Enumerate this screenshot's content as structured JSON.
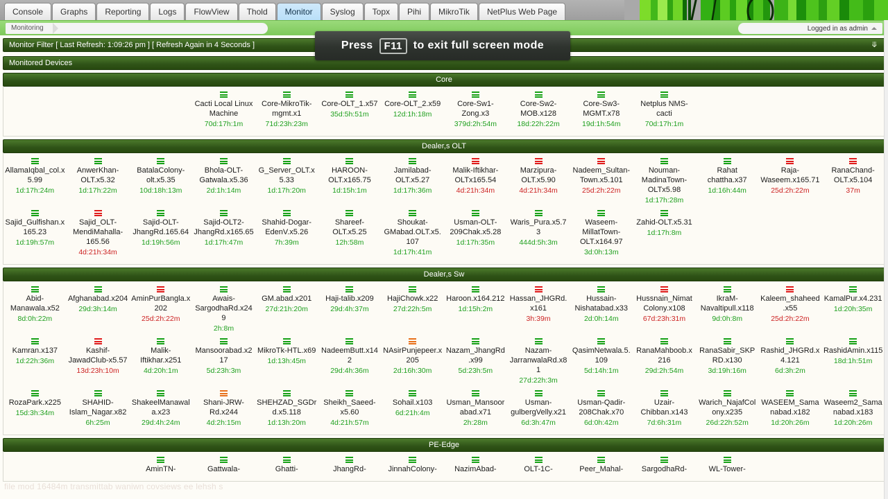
{
  "tabs": [
    {
      "label": "Console",
      "active": false
    },
    {
      "label": "Graphs",
      "active": false
    },
    {
      "label": "Reporting",
      "active": false
    },
    {
      "label": "Logs",
      "active": false
    },
    {
      "label": "FlowView",
      "active": false
    },
    {
      "label": "Thold",
      "active": false
    },
    {
      "label": "Monitor",
      "active": true
    },
    {
      "label": "Syslog",
      "active": false
    },
    {
      "label": "Topx",
      "active": false
    },
    {
      "label": "Pihi",
      "active": false
    },
    {
      "label": "MikroTik",
      "active": false
    },
    {
      "label": "NetPlus Web Page",
      "active": false
    }
  ],
  "breadcrumb": {
    "label": "Monitoring"
  },
  "login": {
    "label": "Logged in as admin"
  },
  "overlay": {
    "prefix": "Press",
    "key": "F11",
    "suffix": "to exit full screen mode"
  },
  "filter_bar": {
    "label": "Monitor Filter [ Last Refresh: 1:09:26 pm ] [ Refresh Again in 4 Seconds ]",
    "chevron": "chevron-double-down-icon"
  },
  "section_header": {
    "label": "Monitored Devices"
  },
  "ghost_text": "file mod 16484m transmittab waniwn  covsiews  ee  lehsh  s",
  "groups": [
    {
      "title": "Core",
      "devices": [
        {
          "name": "",
          "uptime": "",
          "status": "blank"
        },
        {
          "name": "",
          "uptime": "",
          "status": "blank"
        },
        {
          "name": "",
          "uptime": "",
          "status": "blank"
        },
        {
          "name": "Cacti Local Linux Machine",
          "uptime": "70d:17h:1m",
          "status": "up"
        },
        {
          "name": "Core-MikroTik-mgmt.x1",
          "uptime": "71d:23h:23m",
          "status": "up"
        },
        {
          "name": "Core-OLT_1.x57",
          "uptime": "35d:5h:51m",
          "status": "up"
        },
        {
          "name": "Core-OLT_2.x59",
          "uptime": "12d:1h:18m",
          "status": "up"
        },
        {
          "name": "Core-Sw1-Zong.x3",
          "uptime": "379d:2h:54m",
          "status": "up"
        },
        {
          "name": "Core-Sw2-MOB.x128",
          "uptime": "18d:22h:22m",
          "status": "up"
        },
        {
          "name": "Core-Sw3-MGMT.x78",
          "uptime": "19d:1h:54m",
          "status": "up"
        },
        {
          "name": "Netplus NMS-cacti",
          "uptime": "70d:17h:1m",
          "status": "up"
        },
        {
          "name": "",
          "uptime": "",
          "status": "blank"
        },
        {
          "name": "",
          "uptime": "",
          "status": "blank"
        },
        {
          "name": "",
          "uptime": "",
          "status": "blank"
        }
      ]
    },
    {
      "title": "Dealer,s OLT",
      "devices": [
        {
          "name": "AllamaIqbal_col.x5.99",
          "uptime": "1d:17h:24m",
          "status": "up"
        },
        {
          "name": "AnwerKhan-OLT.x5.32",
          "uptime": "1d:17h:22m",
          "status": "up"
        },
        {
          "name": "BatalaColony-olt.x5.35",
          "uptime": "10d:18h:13m",
          "status": "up"
        },
        {
          "name": "Bhola-OLT-Gatwala.x5.36",
          "uptime": "2d:1h:14m",
          "status": "up"
        },
        {
          "name": "G_Server_OLT.x5.33",
          "uptime": "1d:17h:20m",
          "status": "up"
        },
        {
          "name": "HAROON-OLT.x165.75",
          "uptime": "1d:15h:1m",
          "status": "up"
        },
        {
          "name": "Jamilabad-OLT.x5.27",
          "uptime": "1d:17h:36m",
          "status": "up"
        },
        {
          "name": "Malik-Iftikhar-OLTx165.54",
          "uptime": "4d:21h:34m",
          "status": "down"
        },
        {
          "name": "Marzipura-OLT.x5.90",
          "uptime": "4d:21h:34m",
          "status": "down"
        },
        {
          "name": "Nadeem_Sultan-Town.x5.101",
          "uptime": "25d:2h:22m",
          "status": "down"
        },
        {
          "name": "Nouman-MadinaTown-OLTx5.98",
          "uptime": "1d:17h:28m",
          "status": "up"
        },
        {
          "name": "Rahat chattha.x37",
          "uptime": "1d:16h:44m",
          "status": "up"
        },
        {
          "name": "Raja-Waseem.x165.71",
          "uptime": "25d:2h:22m",
          "status": "down"
        },
        {
          "name": "RanaChand-OLT.x5.104",
          "uptime": "37m",
          "status": "down"
        },
        {
          "name": "Sajid_Gulfishan.x165.23",
          "uptime": "1d:19h:57m",
          "status": "up"
        },
        {
          "name": "Sajid_OLT-MendiMahalla-165.56",
          "uptime": "4d:21h:34m",
          "status": "down"
        },
        {
          "name": "Sajid-OLT-JhangRd.165.64",
          "uptime": "1d:19h:56m",
          "status": "up"
        },
        {
          "name": "Sajid-OLT2-JhangRd.x165.65",
          "uptime": "1d:17h:47m",
          "status": "up"
        },
        {
          "name": "Shahid-Dogar-EdenV.x5.26",
          "uptime": "7h:39m",
          "status": "up"
        },
        {
          "name": "Shareef-OLT.x5.25",
          "uptime": "12h:58m",
          "status": "up"
        },
        {
          "name": "Shoukat-GMabad.OLT.x5.107",
          "uptime": "1d:17h:41m",
          "status": "up"
        },
        {
          "name": "Usman-OLT-209Chak.x5.28",
          "uptime": "1d:17h:35m",
          "status": "up"
        },
        {
          "name": "Waris_Pura.x5.73",
          "uptime": "444d:5h:3m",
          "status": "up"
        },
        {
          "name": "Waseem-MillatTown-OLT.x164.97",
          "uptime": "3d:0h:13m",
          "status": "up"
        },
        {
          "name": "Zahid-OLT.x5.31",
          "uptime": "1d:17h:8m",
          "status": "up"
        },
        {
          "name": "",
          "uptime": "",
          "status": "blank"
        },
        {
          "name": "",
          "uptime": "",
          "status": "blank"
        },
        {
          "name": "",
          "uptime": "",
          "status": "blank"
        }
      ]
    },
    {
      "title": "Dealer,s Sw",
      "devices": [
        {
          "name": "Abid-Manawala.x52",
          "uptime": "8d:0h:22m",
          "status": "up"
        },
        {
          "name": "Afghanabad.x204",
          "uptime": "29d:3h:14m",
          "status": "up"
        },
        {
          "name": "AminPurBangla.x202",
          "uptime": "25d:2h:22m",
          "status": "down"
        },
        {
          "name": "Awais-SargodhaRd.x249",
          "uptime": "2h:8m",
          "status": "up"
        },
        {
          "name": "GM.abad.x201",
          "uptime": "27d:21h:20m",
          "status": "up"
        },
        {
          "name": "Haji-talib.x209",
          "uptime": "29d:4h:37m",
          "status": "up"
        },
        {
          "name": "HajiChowk.x22",
          "uptime": "27d:22h:5m",
          "status": "up"
        },
        {
          "name": "Haroon.x164.212",
          "uptime": "1d:15h:2m",
          "status": "up"
        },
        {
          "name": "Hassan_JHGRd.x161",
          "uptime": "3h:39m",
          "status": "down"
        },
        {
          "name": "Hussain-Nishatabad.x33",
          "uptime": "2d:0h:14m",
          "status": "up"
        },
        {
          "name": "Hussnain_Nimat Colony.x108",
          "uptime": "67d:23h:31m",
          "status": "down"
        },
        {
          "name": "IkraM-Navaltipull.x118",
          "uptime": "9d:0h:8m",
          "status": "up"
        },
        {
          "name": "Kaleem_shaheed.x55",
          "uptime": "25d:2h:22m",
          "status": "down"
        },
        {
          "name": "KamalPur.x4.231",
          "uptime": "1d:20h:35m",
          "status": "up"
        },
        {
          "name": "Kamran.x137",
          "uptime": "1d:22h:36m",
          "status": "up"
        },
        {
          "name": "Kashif-JawadClub-x5.57",
          "uptime": "13d:23h:10m",
          "status": "down"
        },
        {
          "name": "Malik-Iftikhar.x251",
          "uptime": "4d:20h:1m",
          "status": "up"
        },
        {
          "name": "Mansoorabad.x217",
          "uptime": "5d:23h:3m",
          "status": "up"
        },
        {
          "name": "MikroTk-HTL.x69",
          "uptime": "1d:13h:45m",
          "status": "up"
        },
        {
          "name": "NadeemButt.x142",
          "uptime": "29d:4h:36m",
          "status": "up"
        },
        {
          "name": "NAsirPunjepeer.x205",
          "uptime": "2d:16h:30m",
          "status": "warn"
        },
        {
          "name": "Nazam_JhangRd.x99",
          "uptime": "5d:23h:5m",
          "status": "up"
        },
        {
          "name": "Nazam-JarranwalaRd.x81",
          "uptime": "27d:22h:3m",
          "status": "up"
        },
        {
          "name": "QasimNetwala.5.109",
          "uptime": "5d:14h:1m",
          "status": "up"
        },
        {
          "name": "RanaMahboob.x216",
          "uptime": "29d:2h:54m",
          "status": "up"
        },
        {
          "name": "RanaSabir_SKPRD.x130",
          "uptime": "3d:19h:16m",
          "status": "up"
        },
        {
          "name": "Rashid_JHGRd.x4.121",
          "uptime": "6d:3h:2m",
          "status": "up"
        },
        {
          "name": "RashidAmin.x115",
          "uptime": "18d:1h:51m",
          "status": "up"
        },
        {
          "name": "RozaPark.x225",
          "uptime": "15d:3h:34m",
          "status": "up"
        },
        {
          "name": "SHAHID-Islam_Nagar.x82",
          "uptime": "6h:25m",
          "status": "up"
        },
        {
          "name": "ShakeelManawala.x23",
          "uptime": "29d:4h:24m",
          "status": "up"
        },
        {
          "name": "Shani-JRW-Rd.x244",
          "uptime": "4d:2h:15m",
          "status": "warn"
        },
        {
          "name": "SHEHZAD_SGDrd.x5.118",
          "uptime": "1d:13h:20m",
          "status": "up"
        },
        {
          "name": "Sheikh_Saeed-x5.60",
          "uptime": "4d:21h:57m",
          "status": "up"
        },
        {
          "name": "Sohail.x103",
          "uptime": "6d:21h:4m",
          "status": "up"
        },
        {
          "name": "Usman_Mansoorabad.x71",
          "uptime": "2h:28m",
          "status": "up"
        },
        {
          "name": "Usman-gulbergVelly.x21",
          "uptime": "6d:3h:47m",
          "status": "up"
        },
        {
          "name": "Usman-Qadir-208Chak.x70",
          "uptime": "6d:0h:42m",
          "status": "up"
        },
        {
          "name": "Uzair-Chibban.x143",
          "uptime": "7d:6h:31m",
          "status": "up"
        },
        {
          "name": "Warich_NajafColony.x235",
          "uptime": "26d:22h:52m",
          "status": "up"
        },
        {
          "name": "WASEEM_Samanabad.x182",
          "uptime": "1d:20h:26m",
          "status": "up"
        },
        {
          "name": "Waseem2_Samanabad.x183",
          "uptime": "1d:20h:26m",
          "status": "up"
        }
      ]
    },
    {
      "title": "PE-Edge",
      "devices": [
        {
          "name": "",
          "uptime": "",
          "status": "blank"
        },
        {
          "name": "",
          "uptime": "",
          "status": "blank"
        },
        {
          "name": "AminTN-",
          "uptime": "",
          "status": "up"
        },
        {
          "name": "Gattwala-",
          "uptime": "",
          "status": "up"
        },
        {
          "name": "Ghatti-",
          "uptime": "",
          "status": "up"
        },
        {
          "name": "JhangRd-",
          "uptime": "",
          "status": "up"
        },
        {
          "name": "JinnahColony-",
          "uptime": "",
          "status": "up"
        },
        {
          "name": "NazimAbad-",
          "uptime": "",
          "status": "up"
        },
        {
          "name": "OLT-1C-",
          "uptime": "",
          "status": "up"
        },
        {
          "name": "Peer_Mahal-",
          "uptime": "",
          "status": "up"
        },
        {
          "name": "SargodhaRd-",
          "uptime": "",
          "status": "up"
        },
        {
          "name": "WL-Tower-",
          "uptime": "",
          "status": "up"
        },
        {
          "name": "",
          "uptime": "",
          "status": "blank"
        },
        {
          "name": "",
          "uptime": "",
          "status": "blank"
        }
      ]
    }
  ]
}
